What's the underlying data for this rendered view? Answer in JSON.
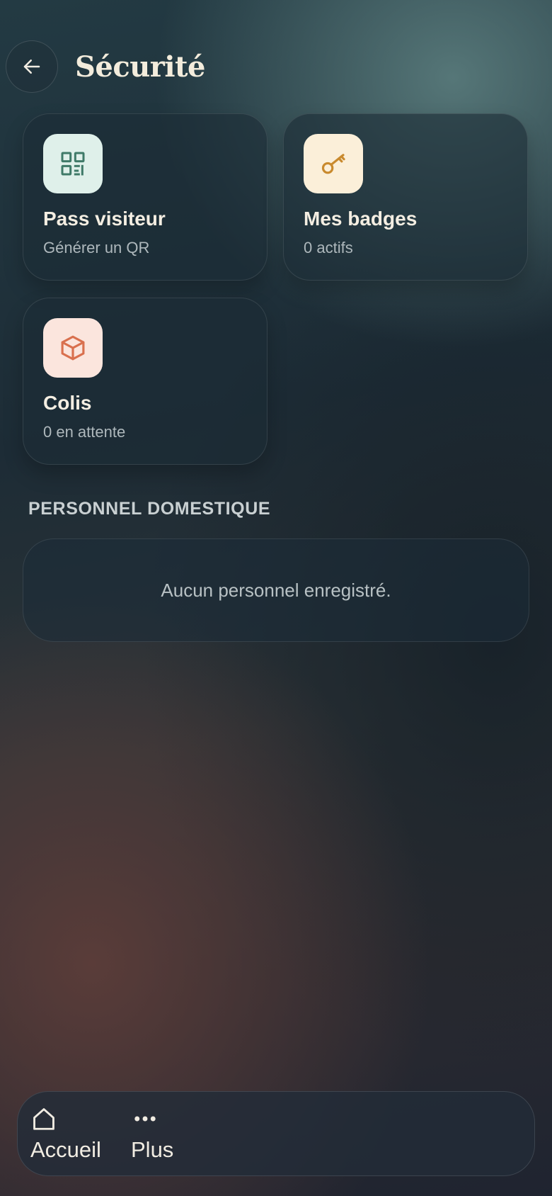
{
  "header": {
    "title": "Sécurité",
    "back_icon": "arrow-left-icon"
  },
  "tiles": [
    {
      "title": "Pass visiteur",
      "subtitle": "Générer un QR",
      "icon": "qr-code-icon",
      "icon_bg": "#dff0ea",
      "icon_color": "#3f7a68"
    },
    {
      "title": "Mes badges",
      "subtitle": "0 actifs",
      "icon": "key-icon",
      "icon_bg": "#fbefd9",
      "icon_color": "#c98a2e"
    },
    {
      "title": "Colis",
      "subtitle": "0 en attente",
      "icon": "package-icon",
      "icon_bg": "#fbe5dd",
      "icon_color": "#d9704e"
    }
  ],
  "staff_section": {
    "title": "PERSONNEL DOMESTIQUE",
    "empty_message": "Aucun personnel enregistré."
  },
  "bottom_nav": {
    "items": [
      {
        "label": "Accueil",
        "icon": "home-icon"
      },
      {
        "label": "Plus",
        "icon": "more-dots-icon"
      }
    ]
  }
}
